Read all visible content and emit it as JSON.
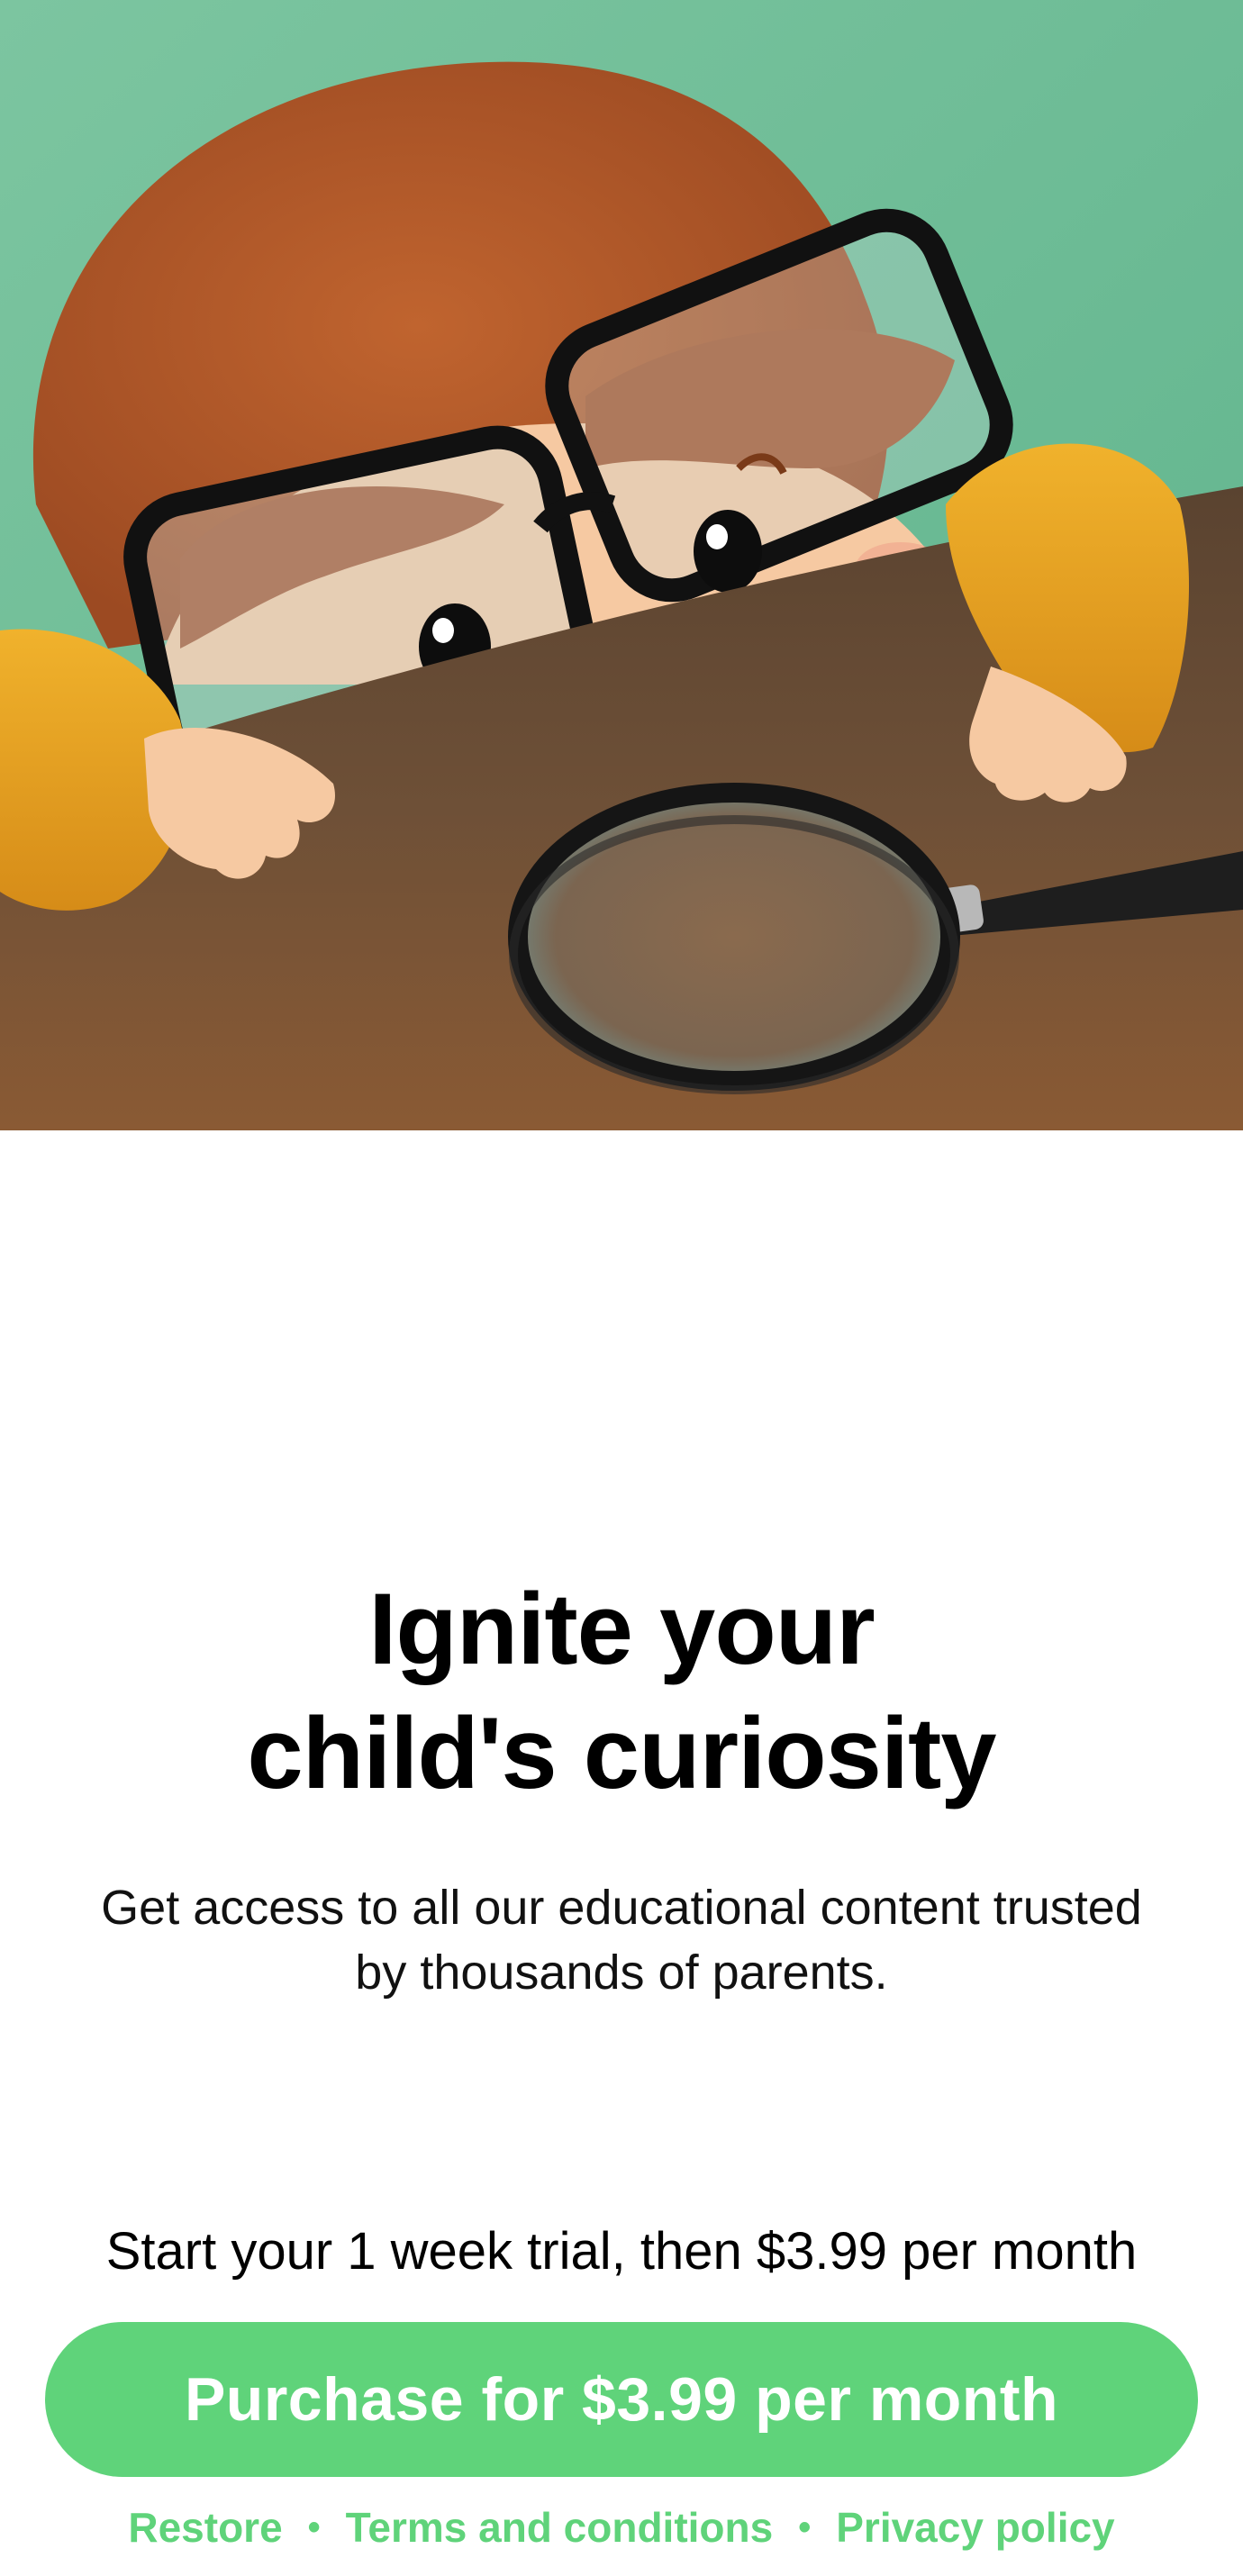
{
  "hero": {
    "image_description_name": "child-with-magnifying-glass-illustration"
  },
  "headline": {
    "line1": "Ignite your",
    "line2": "child's curiosity"
  },
  "subtitle": {
    "line1": "Get access to all our educational content trusted",
    "line2": "by thousands of parents."
  },
  "trial_text": "Start your 1 week trial, then $3.99 per month",
  "purchase_button": {
    "label": "Purchase for $3.99 per month"
  },
  "footer": {
    "restore": "Restore",
    "separator": "•",
    "terms": "Terms and conditions",
    "privacy": "Privacy policy"
  },
  "colors": {
    "accent": "#5fd37a",
    "background": "#ffffff",
    "hero_wall": "#6fbd96",
    "hero_table": "#6e5037",
    "hair": "#b9592a",
    "sleeve": "#e9a21f"
  }
}
